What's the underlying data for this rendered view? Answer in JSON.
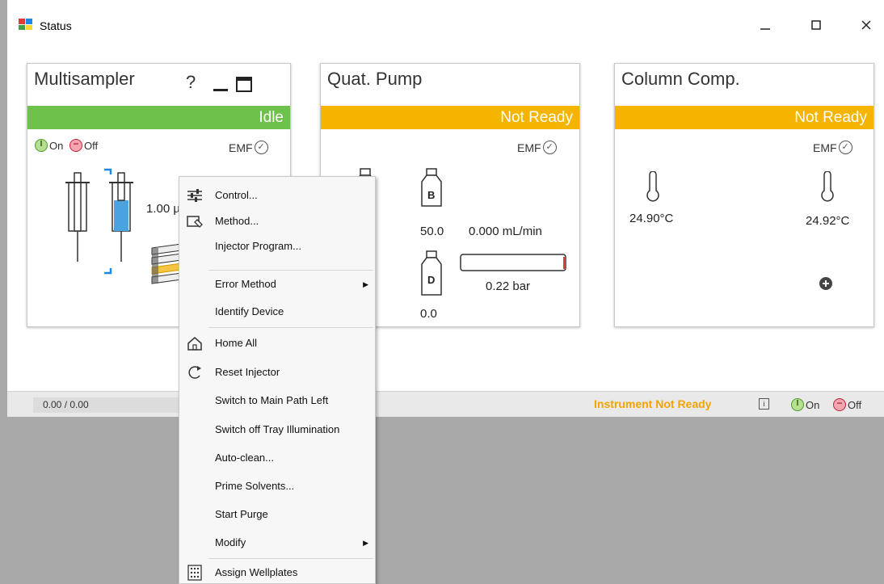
{
  "window": {
    "title": "Status"
  },
  "multisampler": {
    "title": "Multisampler",
    "help": "?",
    "status": "Idle",
    "on_label": "On",
    "off_label": "Off",
    "emf": "EMF",
    "volume": "1.00 µ"
  },
  "pump": {
    "title": "Quat. Pump",
    "status": "Not Ready",
    "emf": "EMF",
    "bottle_b": "B",
    "bottle_d": "D",
    "value_b": "50.0",
    "value_d": "0.0",
    "flow": "0.000 mL/min",
    "pressure": "0.22 bar"
  },
  "column": {
    "title": "Column Comp.",
    "status": "Not Ready",
    "emf": "EMF",
    "temp_left": "24.90°C",
    "temp_right": "24.92°C"
  },
  "bottom": {
    "counter": "0.00 / 0.00",
    "instrument_status": "Instrument Not Ready",
    "info": "i",
    "on_label": "On",
    "off_label": "Off"
  },
  "menu": {
    "items": [
      {
        "label": "Control...",
        "icon": "sliders-icon"
      },
      {
        "label": "Method...",
        "icon": "method-icon"
      },
      {
        "label": "Injector Program..."
      },
      {
        "label": "Error Method",
        "submenu": true
      },
      {
        "label": "Identify Device"
      },
      {
        "label": "Home All",
        "icon": "home-icon"
      },
      {
        "label": "Reset Injector",
        "icon": "reset-icon"
      },
      {
        "label": "Switch to Main Path Left"
      },
      {
        "label": "Switch off Tray Illumination"
      },
      {
        "label": "Auto-clean..."
      },
      {
        "label": "Prime Solvents..."
      },
      {
        "label": "Start Purge"
      },
      {
        "label": "Modify",
        "submenu": true
      },
      {
        "label": "Assign Wellplates",
        "icon": "wellplate-icon"
      }
    ]
  },
  "colors": {
    "idle": "#6cc24a",
    "not_ready": "#f5b400",
    "instrument_not_ready_text": "#f5a300"
  }
}
